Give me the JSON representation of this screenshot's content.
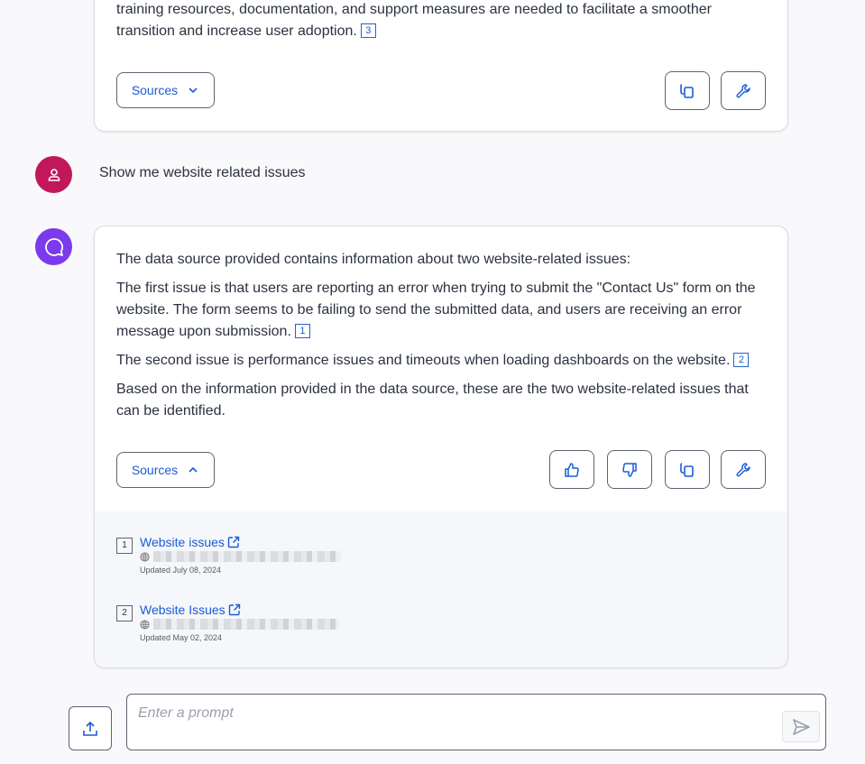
{
  "previous_response": {
    "lines": [
      "training resources, documentation, and support measures are needed to facilitate a smoother",
      "transition and increase user adoption."
    ],
    "citation": "3",
    "sources_label": "Sources",
    "actions": [
      "copy-icon",
      "wrench-icon"
    ]
  },
  "user_message": {
    "text": "Show me website related issues",
    "avatar_icon": "user-icon",
    "avatar_color": "#c2185b"
  },
  "assistant_response": {
    "avatar_icon": "chat-bubble-icon",
    "avatar_color": "#7c3aed",
    "paragraphs": [
      {
        "text": "The data source provided contains information about two website-related issues:",
        "citation": null
      },
      {
        "text": "The first issue is that users are reporting an error when trying to submit the \"Contact Us\" form on the website. The form seems to be failing to send the submitted data, and users are receiving an error message upon submission.",
        "citation": "1"
      },
      {
        "text": "The second issue is performance issues and timeouts when loading dashboards on the website.",
        "citation": "2"
      },
      {
        "text": "Based on the information provided in the data source, these are the two website-related issues that can be identified.",
        "citation": null
      }
    ],
    "sources_label": "Sources",
    "sources_expanded": true,
    "actions": [
      "thumbs-up-icon",
      "thumbs-down-icon",
      "copy-icon",
      "wrench-icon"
    ],
    "sources": [
      {
        "num": "1",
        "title": "Website issues",
        "updated": "Updated July 08, 2024"
      },
      {
        "num": "2",
        "title": "Website Issues",
        "updated": "Updated May 02, 2024"
      }
    ]
  },
  "prompt": {
    "placeholder": "Enter a prompt",
    "value": ""
  },
  "colors": {
    "accent": "#1a5bd6",
    "text": "#2b3240",
    "border": "#5d6470"
  }
}
